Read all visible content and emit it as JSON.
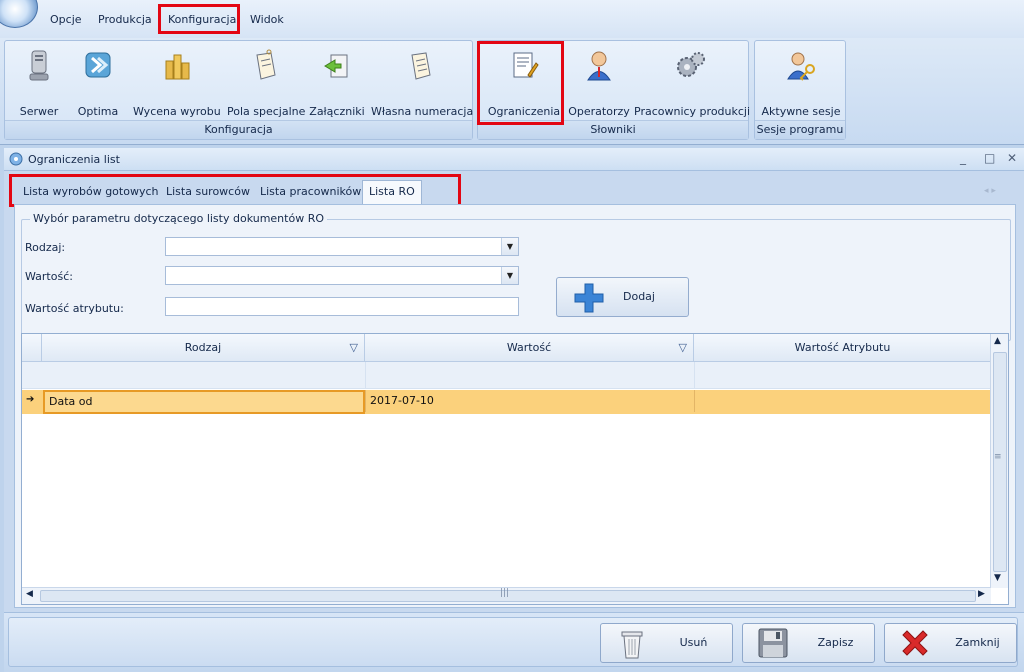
{
  "menubar": {
    "items": [
      "Opcje",
      "Produkcja",
      "Konfiguracja",
      "Widok"
    ]
  },
  "ribbon": {
    "groups": [
      {
        "label": "Konfiguracja",
        "buttons": [
          "Serwer",
          "Optima",
          "Wycena wyrobu",
          "Pola specjalne",
          "Załączniki",
          "Własna numeracja"
        ]
      },
      {
        "label": "Słowniki",
        "buttons": [
          "Ograniczenia",
          "Operatorzy",
          "Pracownicy produkcji"
        ]
      },
      {
        "label": "Sesje programu",
        "buttons": [
          "Aktywne sesje"
        ]
      }
    ]
  },
  "window": {
    "title": "Ograniczenia list",
    "controls": [
      "_",
      "□",
      "✕"
    ]
  },
  "tabs": [
    "Lista wyrobów gotowych",
    "Lista surowców",
    "Lista pracowników",
    "Lista RO"
  ],
  "active_tab": "Lista RO",
  "form": {
    "legend": "Wybór parametru dotyczącego listy dokumentów RO",
    "rodzaj_label": "Rodzaj:",
    "rodzaj_value": "",
    "wartosc_label": "Wartość:",
    "wartosc_value": "",
    "atrybut_label": "Wartość atrybutu:",
    "atrybut_value": "",
    "add_label": "Dodaj"
  },
  "grid": {
    "columns": [
      "Rodzaj",
      "Wartość",
      "Wartość Atrybutu"
    ],
    "rows": [
      [
        "Data od",
        "2017-07-10",
        ""
      ]
    ]
  },
  "footer": {
    "delete_label": "Usuń",
    "save_label": "Zapisz",
    "close_label": "Zamknij"
  },
  "colors": {
    "highlight": "#e30613",
    "selected_row": "#fbd17c"
  }
}
